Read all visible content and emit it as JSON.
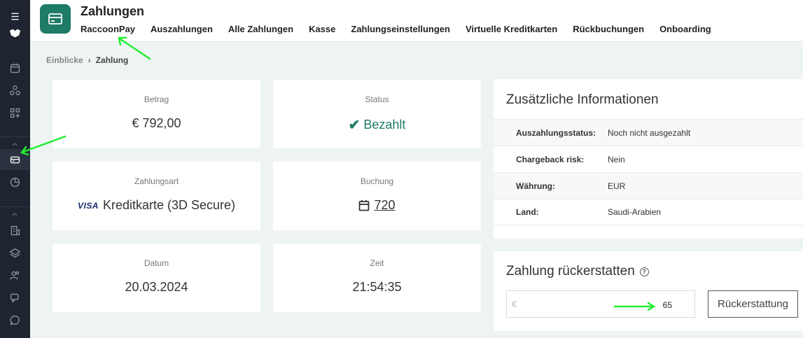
{
  "app": {
    "title": "Zahlungen",
    "icon": "credit-card-icon",
    "accent_color": "#1e7b66"
  },
  "tabs": [
    {
      "label": "RaccoonPay"
    },
    {
      "label": "Auszahlungen"
    },
    {
      "label": "Alle Zahlungen"
    },
    {
      "label": "Kasse"
    },
    {
      "label": "Zahlungseinstellungen"
    },
    {
      "label": "Virtuelle Kreditkarten"
    },
    {
      "label": "Rückbuchungen"
    },
    {
      "label": "Onboarding"
    }
  ],
  "breadcrumb": {
    "parent": "Einblicke",
    "current": "Zahlung"
  },
  "cards": {
    "amount": {
      "label": "Betrag",
      "value": "€ 792,00"
    },
    "status": {
      "label": "Status",
      "value": "Bezahlt",
      "icon": "check-icon"
    },
    "payment_method": {
      "label": "Zahlungsart",
      "brand": "VISA",
      "value": "Kreditkarte (3D Secure)"
    },
    "booking": {
      "label": "Buchung",
      "value": "720",
      "icon": "calendar-icon"
    },
    "date": {
      "label": "Datum",
      "value": "20.03.2024"
    },
    "time": {
      "label": "Zeit",
      "value": "21:54:35"
    }
  },
  "info": {
    "title": "Zusätzliche Informationen",
    "rows": [
      {
        "key": "Auszahlungsstatus:",
        "value": "Noch nicht ausgezahlt"
      },
      {
        "key": "Chargeback risk:",
        "value": "Nein"
      },
      {
        "key": "Währung:",
        "value": "EUR"
      },
      {
        "key": "Land:",
        "value": "Saudi-Arabien"
      }
    ]
  },
  "refund": {
    "title": "Zahlung rückerstatten",
    "help_icon": "?",
    "currency_symbol": "€",
    "amount_value": "65",
    "button_label": "Rückerstattung"
  },
  "sidebar": {
    "icons": [
      "menu-icon",
      "raccoon-logo-icon",
      "calendar-icon",
      "shapes-icon",
      "grid-plus-icon",
      "payments-icon",
      "pie-chart-icon",
      "building-icon",
      "layers-icon",
      "users-icon",
      "chat-icon",
      "help-bubble-icon"
    ]
  }
}
